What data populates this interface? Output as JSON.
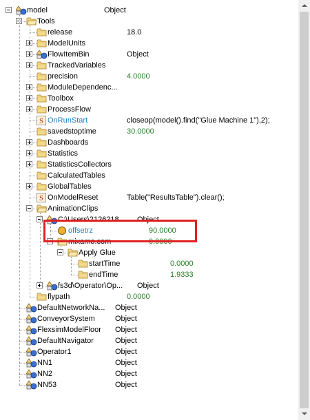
{
  "tree": {
    "rows": [
      {
        "label": "model",
        "value": "Object",
        "icon": "object-icon",
        "expander": "minus",
        "depth": 0
      },
      {
        "label": "Tools",
        "value": "",
        "icon": "folder-open-icon",
        "expander": "minus",
        "depth": 1
      },
      {
        "label": "release",
        "value": "18.0",
        "icon": "folder-icon",
        "expander": "",
        "depth": 2
      },
      {
        "label": "ModelUnits",
        "value": "",
        "icon": "folder-icon",
        "expander": "plus",
        "depth": 2
      },
      {
        "label": "FlowItemBin",
        "value": "Object",
        "icon": "object-icon",
        "expander": "plus",
        "depth": 2
      },
      {
        "label": "TrackedVariables",
        "value": "",
        "icon": "folder-icon",
        "expander": "plus",
        "depth": 2
      },
      {
        "label": "precision",
        "value": "4.0000",
        "icon": "folder-icon",
        "expander": "",
        "depth": 2,
        "value_color": "green"
      },
      {
        "label": "ModuleDependenc...",
        "value": "",
        "icon": "folder-icon",
        "expander": "plus",
        "depth": 2
      },
      {
        "label": "Toolbox",
        "value": "",
        "icon": "folder-icon",
        "expander": "plus",
        "depth": 2
      },
      {
        "label": "ProcessFlow",
        "value": "",
        "icon": "folder-icon",
        "expander": "plus",
        "depth": 2
      },
      {
        "label": "OnRunStart",
        "value": "closeop(model().find(\"Glue Machine 1\"),2);",
        "icon": "script-icon",
        "expander": "",
        "depth": 2,
        "label_color": "blue"
      },
      {
        "label": "savedstoptime",
        "value": "30.0000",
        "icon": "folder-icon",
        "expander": "",
        "depth": 2,
        "value_color": "green"
      },
      {
        "label": "Dashboards",
        "value": "",
        "icon": "folder-icon",
        "expander": "plus",
        "depth": 2
      },
      {
        "label": "Statistics",
        "value": "",
        "icon": "folder-icon",
        "expander": "plus",
        "depth": 2
      },
      {
        "label": "StatisticsCollectors",
        "value": "",
        "icon": "folder-icon",
        "expander": "plus",
        "depth": 2
      },
      {
        "label": "CalculatedTables",
        "value": "",
        "icon": "folder-icon",
        "expander": "",
        "depth": 2
      },
      {
        "label": "GlobalTables",
        "value": "",
        "icon": "folder-icon",
        "expander": "plus",
        "depth": 2
      },
      {
        "label": "OnModelReset",
        "value": "Table(\"ResultsTable\").clear();",
        "icon": "script-icon",
        "expander": "",
        "depth": 2
      },
      {
        "label": "AnimationClips",
        "value": "",
        "icon": "folder-open-icon",
        "expander": "minus",
        "depth": 2
      },
      {
        "label": "C:\\Users\\2126218...",
        "value": "Object",
        "icon": "object-icon",
        "expander": "minus",
        "depth": 3
      },
      {
        "label": "offsetrz",
        "value": "90.0000",
        "icon": "sphere-icon",
        "expander": "",
        "depth": 4,
        "label_color": "blue",
        "value_color": "green"
      },
      {
        "label": "mixamo.com",
        "value": "0.0000",
        "icon": "folder-open-icon",
        "expander": "minus",
        "depth": 4,
        "value_color": "green"
      },
      {
        "label": "Apply Glue",
        "value": "",
        "icon": "folder-open-icon",
        "expander": "minus",
        "depth": 5
      },
      {
        "label": "startTime",
        "value": "0.0000",
        "icon": "folder-icon",
        "expander": "",
        "depth": 6,
        "value_color": "green"
      },
      {
        "label": "endTime",
        "value": "1.9333",
        "icon": "folder-icon",
        "expander": "",
        "depth": 6,
        "value_color": "green"
      },
      {
        "label": "fs3d\\Operator\\Op...",
        "value": "Object",
        "icon": "object-icon",
        "expander": "plus",
        "depth": 3
      },
      {
        "label": "flypath",
        "value": "0.0000",
        "icon": "folder-icon",
        "expander": "",
        "depth": 2,
        "value_color": "green"
      },
      {
        "label": "DefaultNetworkNa...",
        "value": "Object",
        "icon": "object-icon",
        "expander": "",
        "depth": 1
      },
      {
        "label": "ConveyorSystem",
        "value": "Object",
        "icon": "object-icon",
        "expander": "",
        "depth": 1
      },
      {
        "label": "FlexsimModelFloor",
        "value": "Object",
        "icon": "object-icon",
        "expander": "",
        "depth": 1
      },
      {
        "label": "DefaultNavigator",
        "value": "Object",
        "icon": "object-icon",
        "expander": "",
        "depth": 1
      },
      {
        "label": "Operator1",
        "value": "Object",
        "icon": "object-icon",
        "expander": "",
        "depth": 1
      },
      {
        "label": "NN1",
        "value": "Object",
        "icon": "object-icon",
        "expander": "",
        "depth": 1
      },
      {
        "label": "NN2",
        "value": "Object",
        "icon": "object-icon",
        "expander": "",
        "depth": 1
      },
      {
        "label": "NN53",
        "value": "Object",
        "icon": "object-icon",
        "expander": "",
        "depth": 1
      }
    ]
  },
  "colors": {
    "value_green": "#2a7d2a",
    "label_blue": "#1a7fc4",
    "highlight_red": "#e02020"
  }
}
